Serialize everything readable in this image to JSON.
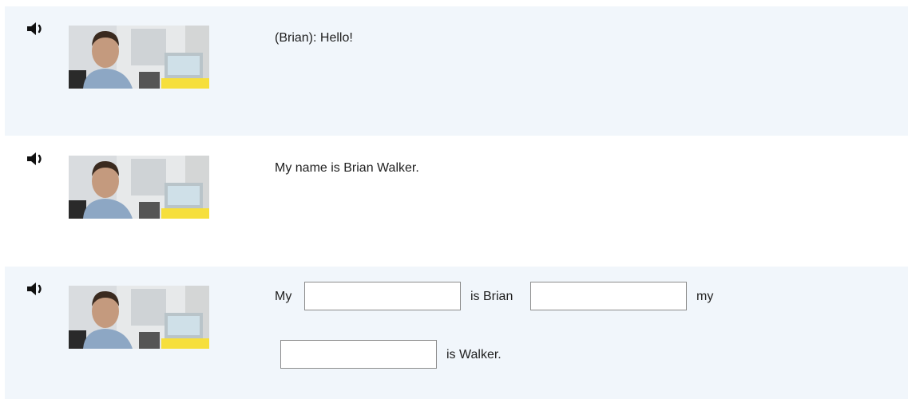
{
  "rows": [
    {
      "speaker_icon": "speaker-icon",
      "photo_alt": "Brian",
      "text": "(Brian): Hello!"
    },
    {
      "speaker_icon": "speaker-icon",
      "photo_alt": "Brian",
      "text": "My name is Brian Walker."
    },
    {
      "speaker_icon": "speaker-icon",
      "photo_alt": "Brian",
      "cloze": {
        "word_1": "My",
        "word_2": "is Brian",
        "word_3": "my",
        "word_4": "is Walker.",
        "blank_1": "",
        "blank_2": "",
        "blank_3": ""
      }
    }
  ],
  "colors": {
    "row_shade": "#f1f6fb",
    "input_border": "#8c8c8c"
  }
}
